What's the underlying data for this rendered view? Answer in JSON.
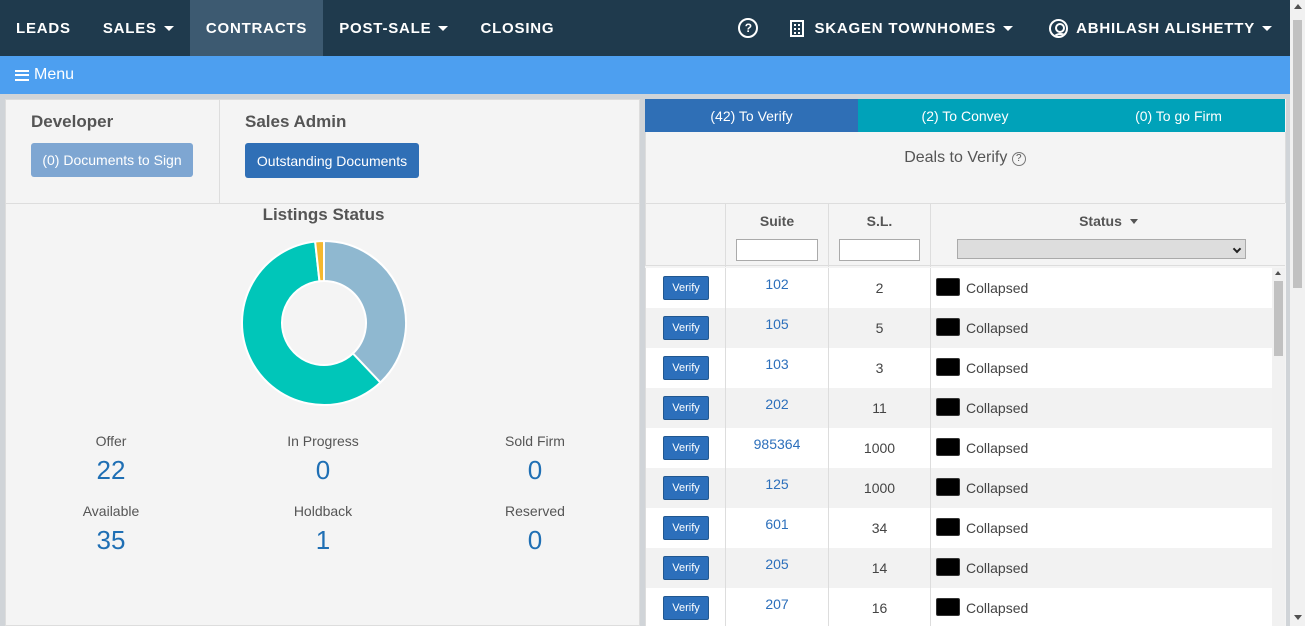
{
  "nav": {
    "items": [
      {
        "label": "LEADS",
        "dropdown": false,
        "active": false
      },
      {
        "label": "SALES",
        "dropdown": true,
        "active": false
      },
      {
        "label": "CONTRACTS",
        "dropdown": false,
        "active": true
      },
      {
        "label": "POST-SALE",
        "dropdown": true,
        "active": false
      },
      {
        "label": "CLOSING",
        "dropdown": false,
        "active": false
      }
    ],
    "help_icon": "?",
    "project": "SKAGEN TOWNHOMES",
    "user": "ABHILASH ALISHETTY"
  },
  "menubar": {
    "label": "Menu"
  },
  "developer": {
    "title": "Developer",
    "button": "(0) Documents to Sign"
  },
  "sales_admin": {
    "title": "Sales Admin",
    "button": "Outstanding Documents"
  },
  "listings": {
    "title": "Listings Status",
    "stats": [
      {
        "label": "Offer",
        "value": "22"
      },
      {
        "label": "In Progress",
        "value": "0"
      },
      {
        "label": "Sold Firm",
        "value": "0"
      },
      {
        "label": "Available",
        "value": "35"
      },
      {
        "label": "Holdback",
        "value": "1"
      },
      {
        "label": "Reserved",
        "value": "0"
      }
    ],
    "chart_data": {
      "type": "pie",
      "donut": true,
      "slices": [
        {
          "label": "Offer",
          "value": 22,
          "color": "#8fb8d0"
        },
        {
          "label": "Available",
          "value": 35,
          "color": "#00c6b9"
        },
        {
          "label": "Holdback",
          "value": 1,
          "color": "#f5b82e"
        }
      ]
    }
  },
  "tabs": [
    {
      "label": "(42) To Verify",
      "color": "#2f6fb6"
    },
    {
      "label": "(2) To Convey",
      "color": "#00a2b9"
    },
    {
      "label": "(0) To go Firm",
      "color": "#00a2b9"
    }
  ],
  "deals": {
    "title": "Deals to Verify",
    "help": "?"
  },
  "table": {
    "headers": {
      "suite": "Suite",
      "sl": "S.L.",
      "status": "Status"
    },
    "verify_label": "Verify",
    "rows": [
      {
        "suite": "102",
        "sl": "2",
        "status": "Collapsed"
      },
      {
        "suite": "105",
        "sl": "5",
        "status": "Collapsed"
      },
      {
        "suite": "103",
        "sl": "3",
        "status": "Collapsed"
      },
      {
        "suite": "202",
        "sl": "11",
        "status": "Collapsed"
      },
      {
        "suite": "985364",
        "sl": "1000",
        "status": "Collapsed"
      },
      {
        "suite": "125",
        "sl": "1000",
        "status": "Collapsed"
      },
      {
        "suite": "601",
        "sl": "34",
        "status": "Collapsed"
      },
      {
        "suite": "205",
        "sl": "14",
        "status": "Collapsed"
      },
      {
        "suite": "207",
        "sl": "16",
        "status": "Collapsed"
      }
    ]
  }
}
